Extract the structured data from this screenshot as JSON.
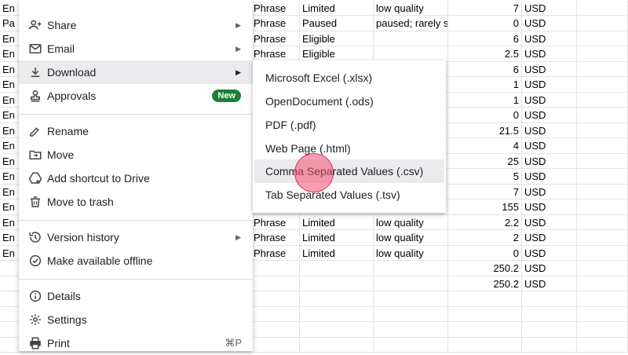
{
  "sheet": {
    "rows": [
      [
        "En",
        "Phrase",
        "Limited",
        "low quality",
        "7",
        "USD"
      ],
      [
        "Pa",
        "Phrase",
        "Paused",
        "paused; rarely sh",
        "0",
        "USD"
      ],
      [
        "En",
        "Phrase",
        "Eligible",
        "",
        "6",
        "USD"
      ],
      [
        "En",
        "Phrase",
        "Eligible",
        "",
        "2.5",
        "USD"
      ],
      [
        "En",
        "",
        "",
        "",
        "6",
        "USD"
      ],
      [
        "En",
        "",
        "",
        "",
        "1",
        "USD"
      ],
      [
        "En",
        "",
        "",
        "",
        "1",
        "USD"
      ],
      [
        "En",
        "",
        "",
        "",
        "0",
        "USD"
      ],
      [
        "En",
        "",
        "",
        "",
        "21.5",
        "USD"
      ],
      [
        "En",
        "",
        "",
        "",
        "4",
        "USD"
      ],
      [
        "En",
        "",
        "",
        "",
        "25",
        "USD"
      ],
      [
        "En",
        "",
        "",
        "",
        "5",
        "USD"
      ],
      [
        "En",
        "",
        "",
        "",
        "7",
        "USD"
      ],
      [
        "En",
        "",
        "",
        "",
        "155",
        "USD"
      ],
      [
        "En",
        "Phrase",
        "Limited",
        "low quality",
        "2.2",
        "USD"
      ],
      [
        "En",
        "Phrase",
        "Limited",
        "low quality",
        "2",
        "USD"
      ],
      [
        "En",
        "Phrase",
        "Limited",
        "low quality",
        "0",
        "USD"
      ],
      [
        "",
        "",
        "",
        "",
        "250.2",
        "USD"
      ],
      [
        "",
        "",
        "",
        "",
        "250.2",
        "USD"
      ],
      [
        "",
        "",
        "",
        "",
        "",
        ""
      ],
      [
        "",
        "",
        "",
        "",
        "",
        ""
      ],
      [
        "",
        "",
        "",
        "",
        "",
        ""
      ],
      [
        "",
        "",
        "",
        "",
        "",
        ""
      ]
    ]
  },
  "menu": {
    "share": "Share",
    "email": "Email",
    "download": "Download",
    "approvals": "Approvals",
    "approvals_badge": "New",
    "rename": "Rename",
    "move": "Move",
    "add_shortcut": "Add shortcut to Drive",
    "move_to_trash": "Move to trash",
    "version_history": "Version history",
    "offline": "Make available offline",
    "details": "Details",
    "settings": "Settings",
    "print": "Print",
    "print_shortcut": "⌘P"
  },
  "submenu": {
    "items": [
      "Microsoft Excel (.xlsx)",
      "OpenDocument (.ods)",
      "PDF (.pdf)",
      "Web Page (.html)",
      "Comma Separated Values (.csv)",
      "Tab Separated Values (.tsv)"
    ]
  },
  "colors": {
    "highlight": "#ebebee",
    "badge": "#188038",
    "cursor": "#f0506e"
  },
  "icons": {
    "share": "person-add-icon",
    "email": "mail-icon",
    "download": "download-icon",
    "approvals": "stamp-icon",
    "rename": "pencil-icon",
    "move": "folder-move-icon",
    "add_shortcut": "drive-shortcut-icon",
    "trash": "trash-icon",
    "history": "history-icon",
    "offline": "offline-check-icon",
    "details": "info-icon",
    "settings": "gear-icon",
    "print": "printer-icon"
  }
}
